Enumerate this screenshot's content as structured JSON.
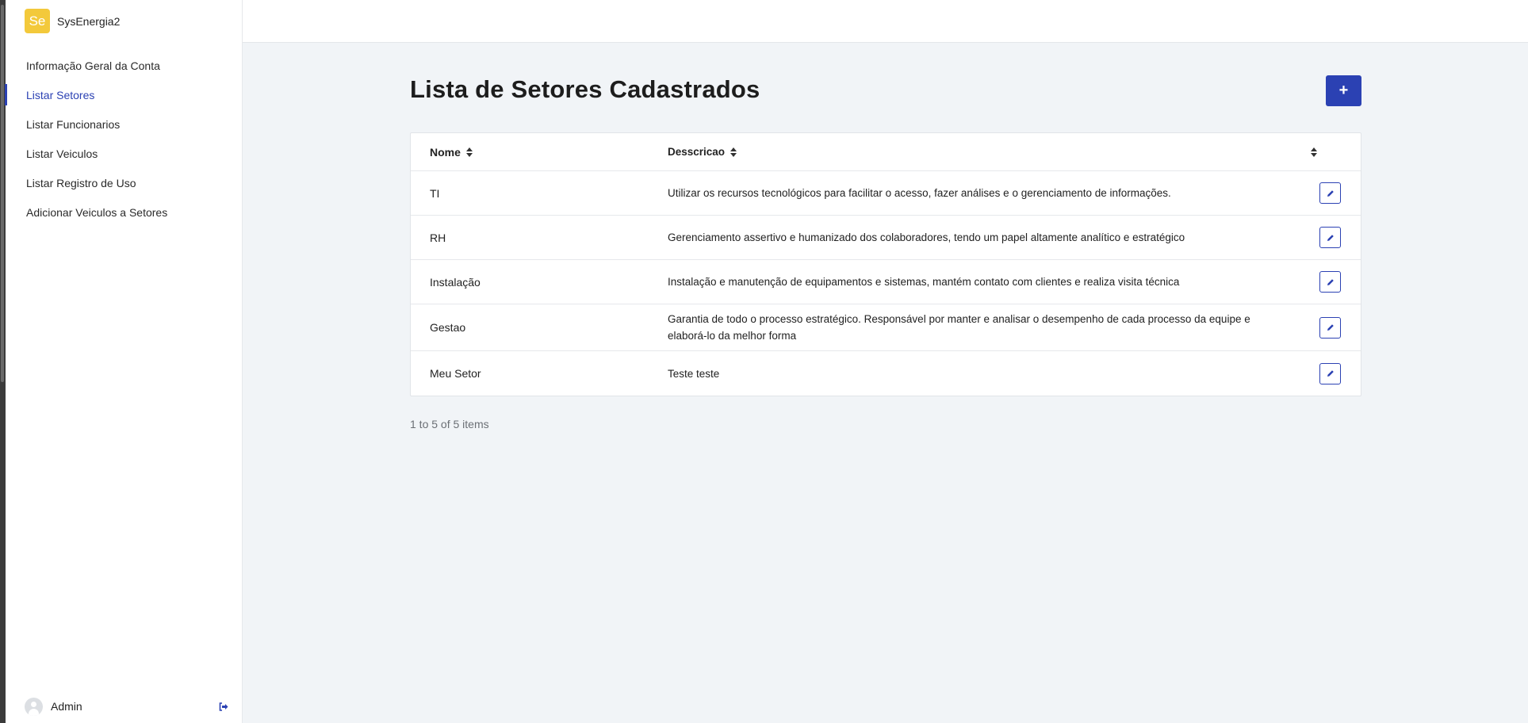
{
  "brand": {
    "badge": "Se",
    "name": "SysEnergia2"
  },
  "sidebar": {
    "items": [
      {
        "label": "Informação Geral da Conta",
        "active": false
      },
      {
        "label": "Listar Setores",
        "active": true
      },
      {
        "label": "Listar Funcionarios",
        "active": false
      },
      {
        "label": "Listar Veiculos",
        "active": false
      },
      {
        "label": "Listar Registro de Uso",
        "active": false
      },
      {
        "label": "Adicionar Veiculos a Setores",
        "active": false
      }
    ],
    "user": {
      "name": "Admin",
      "avatar_icon": "user-avatar-icon",
      "logout_icon": "logout-icon"
    }
  },
  "main": {
    "title": "Lista de Setores Cadastrados",
    "add_button": {
      "label": "+",
      "icon": "plus-icon"
    },
    "table": {
      "columns": [
        "Nome",
        "Desscricao"
      ],
      "rows": [
        {
          "nome": "TI",
          "descricao": "Utilizar os recursos tecnológicos para facilitar o acesso, fazer análises e o gerenciamento de informações."
        },
        {
          "nome": "RH",
          "descricao": "Gerenciamento assertivo e humanizado dos colaboradores, tendo um papel altamente analítico e estratégico"
        },
        {
          "nome": "Instalação",
          "descricao": "Instalação e manutenção de equipamentos e sistemas, mantém contato com clientes e realiza visita técnica"
        },
        {
          "nome": "Gestao",
          "descricao": "Garantia de todo o processo estratégico. Responsável por manter e analisar o desempenho de cada processo da equipe e elaborá-lo da melhor forma"
        },
        {
          "nome": "Meu Setor",
          "descricao": "Teste teste"
        }
      ]
    },
    "pagination": "1 to 5 of 5 items"
  },
  "colors": {
    "accent": "#2b41b3",
    "brand_badge": "#f3c93b",
    "background": "#f1f4f7"
  }
}
